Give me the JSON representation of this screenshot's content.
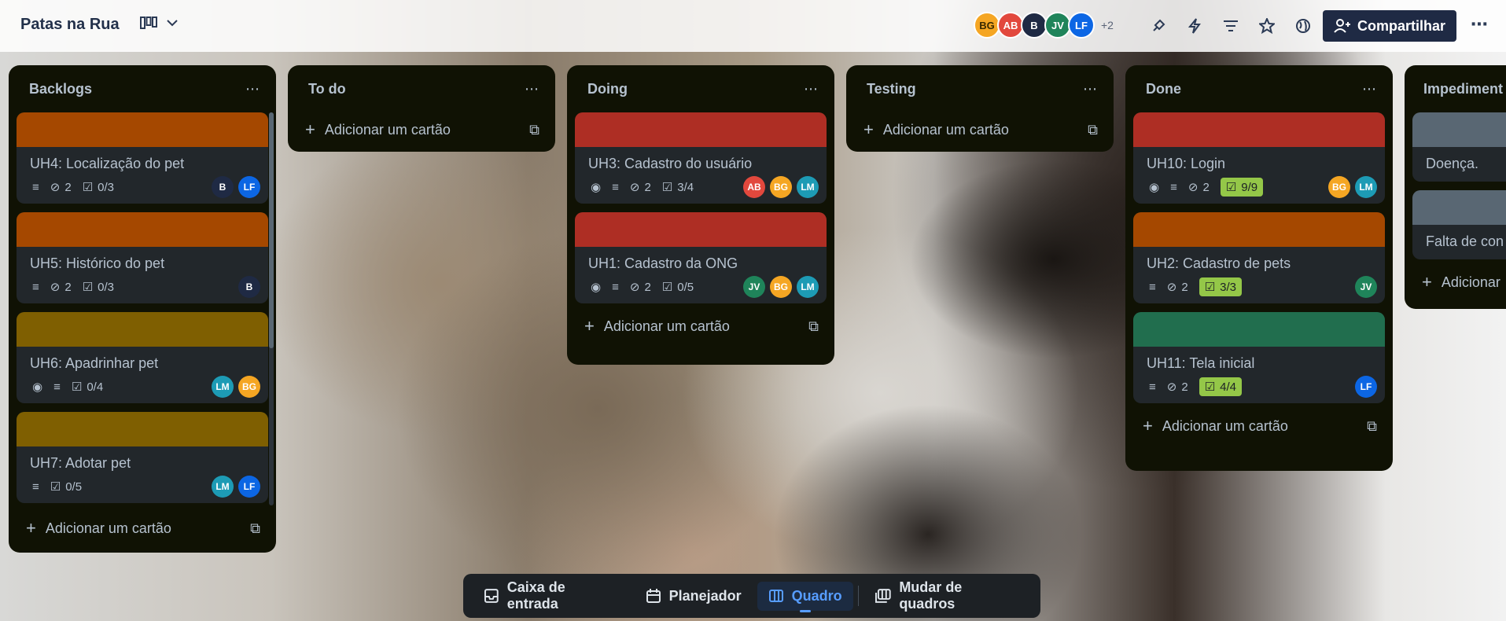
{
  "header": {
    "board_title": "Patas na Rua",
    "members": [
      {
        "initials": "BG",
        "color": "#f5a623"
      },
      {
        "initials": "AB",
        "color": "#e2483d"
      },
      {
        "initials": "B",
        "color": "#1f2a44"
      },
      {
        "initials": "JV",
        "color": "#1f845a"
      },
      {
        "initials": "LF",
        "color": "#0c66e4"
      }
    ],
    "more_members": "+2",
    "share_label": "Compartilhar"
  },
  "lists": [
    {
      "title": "Backlogs",
      "cards": [
        {
          "cover": "#a54800",
          "title": "UH4: Localização do pet",
          "attachments": "2",
          "checklist": "0/3",
          "members": [
            "B",
            "LF"
          ]
        },
        {
          "cover": "#a54800",
          "title": "UH5: Histórico do pet",
          "attachments": "2",
          "checklist": "0/3",
          "members": [
            "B"
          ]
        },
        {
          "cover": "#7f5f01",
          "title": "UH6: Apadrinhar pet",
          "checklist": "0/4",
          "members": [
            "LM",
            "BG"
          ]
        },
        {
          "cover": "#7f5f01",
          "title": "UH7: Adotar pet",
          "checklist": "0/5",
          "members": [
            "LM",
            "LF"
          ]
        }
      ],
      "add_label": "Adicionar um cartão"
    },
    {
      "title": "To do",
      "cards": [],
      "add_label": "Adicionar um cartão"
    },
    {
      "title": "Doing",
      "cards": [
        {
          "cover": "#ae2e24",
          "title": "UH3: Cadastro do usuário",
          "attachments": "2",
          "checklist": "3/4",
          "members": [
            "AB",
            "BG",
            "LM"
          ]
        },
        {
          "cover": "#ae2e24",
          "title": "UH1: Cadastro da ONG",
          "attachments": "2",
          "checklist": "0/5",
          "members": [
            "JV",
            "BG",
            "LM"
          ]
        }
      ],
      "add_label": "Adicionar um cartão"
    },
    {
      "title": "Testing",
      "cards": [],
      "add_label": "Adicionar um cartão"
    },
    {
      "title": "Done",
      "cards": [
        {
          "cover": "#ae2e24",
          "title": "UH10: Login",
          "attachments": "2",
          "checklist": "9/9",
          "members": [
            "BG",
            "LM"
          ]
        },
        {
          "cover": "#a54800",
          "title": "UH2: Cadastro de pets",
          "attachments": "2",
          "checklist": "3/3",
          "members": [
            "JV"
          ]
        },
        {
          "cover": "#216e4e",
          "title": "UH11: Tela inicial",
          "attachments": "2",
          "checklist": "4/4",
          "members": [
            "LF"
          ]
        }
      ],
      "add_label": "Adicionar um cartão"
    },
    {
      "title": "Impediment",
      "cards": [
        {
          "cover": "#596773",
          "title": "Doença."
        },
        {
          "cover": "#596773",
          "title": "Falta de con"
        }
      ],
      "add_label": "Adicionar"
    }
  ],
  "bottom_nav": {
    "inbox": "Caixa de entrada",
    "planner": "Planejador",
    "board": "Quadro",
    "switch": "Mudar de quadros"
  },
  "member_colors": {
    "B": "#1f2a44",
    "LF": "#0c66e4",
    "LM": "#1d9bb5",
    "BG": "#f5a623",
    "AB": "#e2483d",
    "JV": "#1f845a"
  }
}
